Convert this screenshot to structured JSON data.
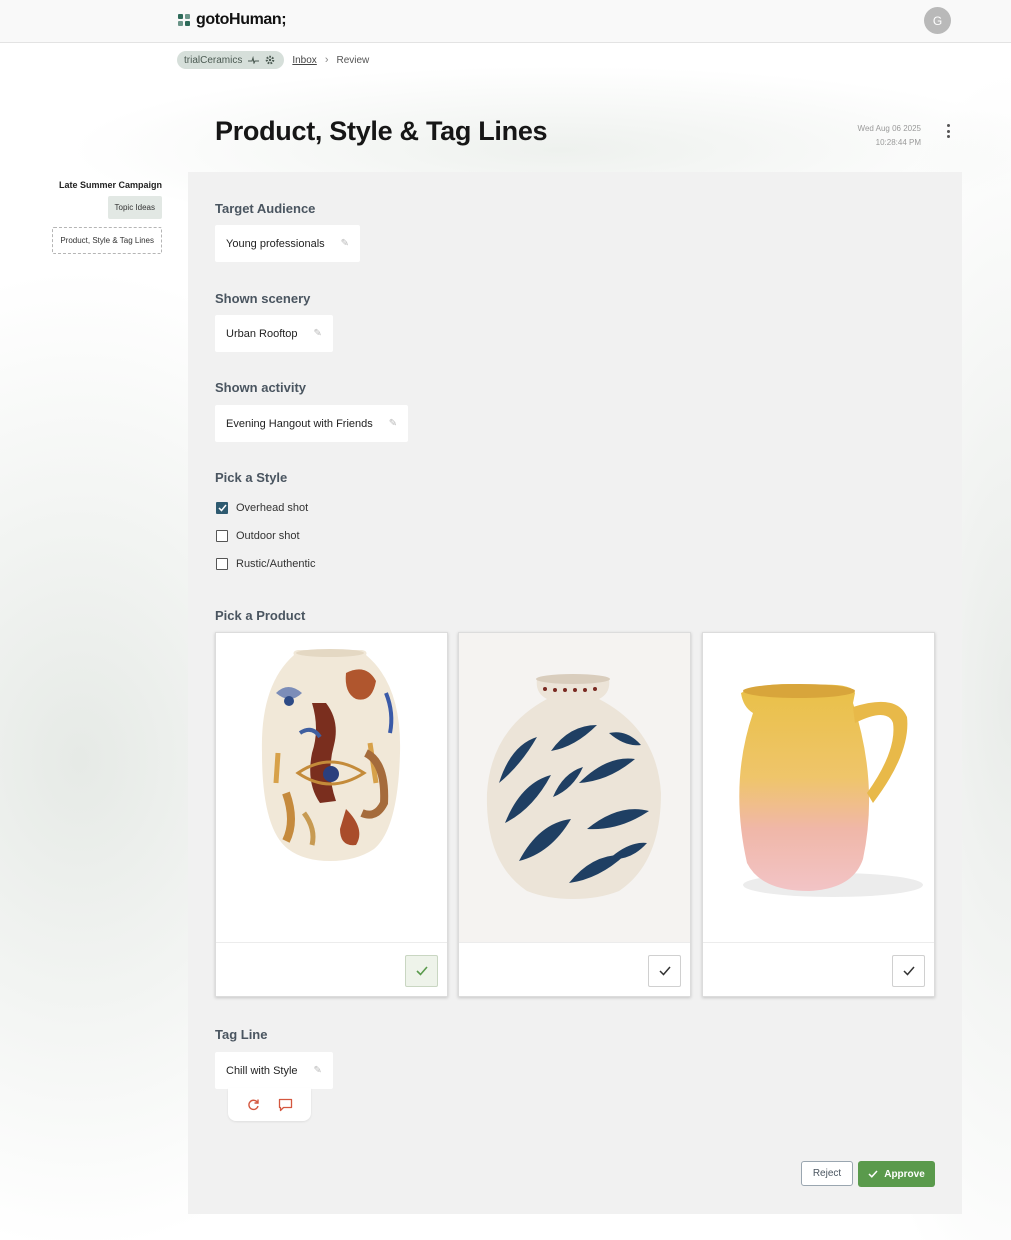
{
  "app": {
    "logo_text": "gotoHuman;",
    "user_initial": "G"
  },
  "breadcrumb": {
    "org": "trialCeramics",
    "inbox": "Inbox",
    "current": "Review"
  },
  "review": {
    "title": "Product, Style & Tag Lines",
    "date": "Wed Aug 06 2025",
    "time": "10:28:44 PM"
  },
  "sidebar": {
    "heading": "Late Summer Campaign",
    "items": [
      {
        "label": "Topic Ideas"
      },
      {
        "label": "Product, Style & Tag Lines"
      }
    ]
  },
  "fields": {
    "audience": {
      "label": "Target Audience",
      "value": "Young professionals"
    },
    "scenery": {
      "label": "Shown scenery",
      "value": "Urban Rooftop"
    },
    "activity": {
      "label": "Shown activity",
      "value": "Evening Hangout with Friends"
    },
    "style": {
      "label": "Pick a Style",
      "options": [
        {
          "label": "Overhead shot",
          "checked": true
        },
        {
          "label": "Outdoor shot",
          "checked": false
        },
        {
          "label": "Rustic/Authentic",
          "checked": false
        }
      ]
    },
    "product": {
      "label": "Pick a Product",
      "items": [
        {
          "name": "painted-face-vase",
          "selected": true
        },
        {
          "name": "blue-leaf-vase",
          "selected": false
        },
        {
          "name": "yellow-pink-pitcher",
          "selected": false
        }
      ]
    },
    "tagline": {
      "label": "Tag Line",
      "value": "Chill with Style"
    }
  },
  "actions": {
    "reject": "Reject",
    "approve": "Approve"
  },
  "colors": {
    "accent_green": "#5a9a4c",
    "checkbox_on": "#2e5a70",
    "panel_bg": "#f1f1f1"
  }
}
